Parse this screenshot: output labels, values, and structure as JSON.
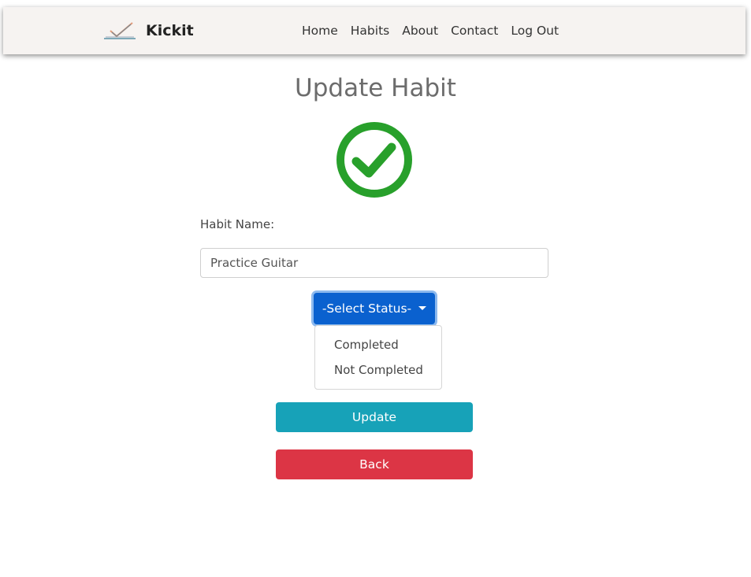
{
  "navbar": {
    "brand": "Kickit",
    "links": [
      "Home",
      "Habits",
      "About",
      "Contact",
      "Log Out"
    ]
  },
  "page": {
    "title": "Update Habit",
    "status_icon": "check-circle-icon",
    "habit_label": "Habit Name:",
    "habit_value": "Practice Guitar",
    "status_select": {
      "label": "-Select Status-",
      "options": [
        "Completed",
        "Not Completed"
      ]
    },
    "update_label": "Update",
    "back_label": "Back"
  },
  "colors": {
    "navbar_bg": "#f6f3f1",
    "check_green": "#28a02b",
    "select_blue": "#0a61cf",
    "update_teal": "#17a2b8",
    "back_red": "#dc3545"
  }
}
